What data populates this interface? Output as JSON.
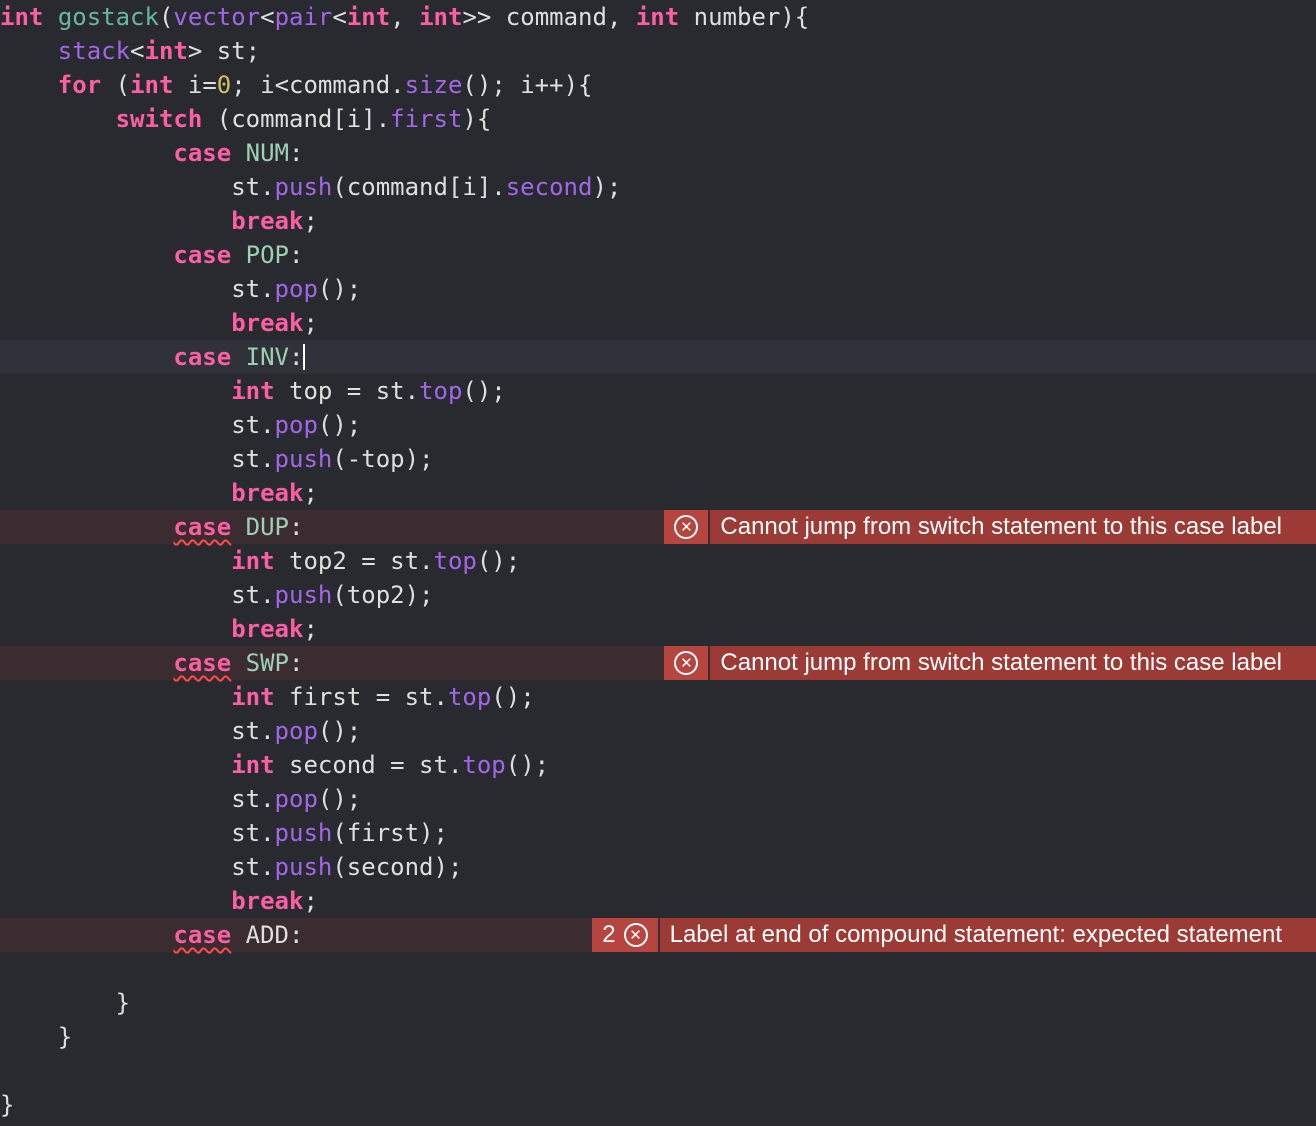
{
  "editor": {
    "lines": [
      {
        "tokens": [
          {
            "t": "int",
            "c": "kw"
          },
          {
            "t": " ",
            "c": "pl"
          },
          {
            "t": "gostack",
            "c": "fn"
          },
          {
            "t": "(",
            "c": "pl"
          },
          {
            "t": "vector",
            "c": "mem"
          },
          {
            "t": "<",
            "c": "pl"
          },
          {
            "t": "pair",
            "c": "mem"
          },
          {
            "t": "<",
            "c": "pl"
          },
          {
            "t": "int",
            "c": "kw"
          },
          {
            "t": ", ",
            "c": "pl"
          },
          {
            "t": "int",
            "c": "kw"
          },
          {
            "t": ">> command, ",
            "c": "pl"
          },
          {
            "t": "int",
            "c": "kw"
          },
          {
            "t": " number){",
            "c": "pl"
          }
        ]
      },
      {
        "tokens": [
          {
            "t": "    ",
            "c": "pl"
          },
          {
            "t": "stack",
            "c": "mem"
          },
          {
            "t": "<",
            "c": "pl"
          },
          {
            "t": "int",
            "c": "kw"
          },
          {
            "t": "> st;",
            "c": "pl"
          }
        ]
      },
      {
        "tokens": [
          {
            "t": "    ",
            "c": "pl"
          },
          {
            "t": "for",
            "c": "kw"
          },
          {
            "t": " (",
            "c": "pl"
          },
          {
            "t": "int",
            "c": "kw"
          },
          {
            "t": " i=",
            "c": "pl"
          },
          {
            "t": "0",
            "c": "num"
          },
          {
            "t": "; i<command.",
            "c": "pl"
          },
          {
            "t": "size",
            "c": "mem"
          },
          {
            "t": "(); i++){",
            "c": "pl"
          }
        ]
      },
      {
        "tokens": [
          {
            "t": "        ",
            "c": "pl"
          },
          {
            "t": "switch",
            "c": "kw"
          },
          {
            "t": " (command[i].",
            "c": "pl"
          },
          {
            "t": "first",
            "c": "mem"
          },
          {
            "t": "){",
            "c": "pl"
          }
        ]
      },
      {
        "tokens": [
          {
            "t": "            ",
            "c": "pl"
          },
          {
            "t": "case",
            "c": "kw"
          },
          {
            "t": " ",
            "c": "pl"
          },
          {
            "t": "NUM",
            "c": "enum"
          },
          {
            "t": ":",
            "c": "pl"
          }
        ]
      },
      {
        "tokens": [
          {
            "t": "                st.",
            "c": "pl"
          },
          {
            "t": "push",
            "c": "mem"
          },
          {
            "t": "(command[i].",
            "c": "pl"
          },
          {
            "t": "second",
            "c": "mem"
          },
          {
            "t": ");",
            "c": "pl"
          }
        ]
      },
      {
        "tokens": [
          {
            "t": "                ",
            "c": "pl"
          },
          {
            "t": "break",
            "c": "kw"
          },
          {
            "t": ";",
            "c": "pl"
          }
        ]
      },
      {
        "tokens": [
          {
            "t": "            ",
            "c": "pl"
          },
          {
            "t": "case",
            "c": "kw"
          },
          {
            "t": " ",
            "c": "pl"
          },
          {
            "t": "POP",
            "c": "enum"
          },
          {
            "t": ":",
            "c": "pl"
          }
        ]
      },
      {
        "tokens": [
          {
            "t": "                st.",
            "c": "pl"
          },
          {
            "t": "pop",
            "c": "mem"
          },
          {
            "t": "();",
            "c": "pl"
          }
        ]
      },
      {
        "tokens": [
          {
            "t": "                ",
            "c": "pl"
          },
          {
            "t": "break",
            "c": "kw"
          },
          {
            "t": ";",
            "c": "pl"
          }
        ]
      },
      {
        "current": true,
        "tokens": [
          {
            "t": "            ",
            "c": "pl"
          },
          {
            "t": "case",
            "c": "kw"
          },
          {
            "t": " ",
            "c": "pl"
          },
          {
            "t": "INV",
            "c": "enum"
          },
          {
            "t": ":",
            "c": "pl"
          }
        ]
      },
      {
        "tokens": [
          {
            "t": "                ",
            "c": "pl"
          },
          {
            "t": "int",
            "c": "kw"
          },
          {
            "t": " top = st.",
            "c": "pl"
          },
          {
            "t": "top",
            "c": "mem"
          },
          {
            "t": "();",
            "c": "pl"
          }
        ]
      },
      {
        "tokens": [
          {
            "t": "                st.",
            "c": "pl"
          },
          {
            "t": "pop",
            "c": "mem"
          },
          {
            "t": "();",
            "c": "pl"
          }
        ]
      },
      {
        "tokens": [
          {
            "t": "                st.",
            "c": "pl"
          },
          {
            "t": "push",
            "c": "mem"
          },
          {
            "t": "(-top);",
            "c": "pl"
          }
        ]
      },
      {
        "tokens": [
          {
            "t": "                ",
            "c": "pl"
          },
          {
            "t": "break",
            "c": "kw"
          },
          {
            "t": ";",
            "c": "pl"
          }
        ]
      },
      {
        "error": {
          "message": "Cannot jump from switch statement to this case label",
          "count": ""
        },
        "tokens": [
          {
            "t": "            ",
            "c": "pl"
          },
          {
            "t": "case",
            "c": "kw",
            "err": true
          },
          {
            "t": " ",
            "c": "pl"
          },
          {
            "t": "DUP",
            "c": "enum"
          },
          {
            "t": ":",
            "c": "pl"
          }
        ]
      },
      {
        "tokens": [
          {
            "t": "                ",
            "c": "pl"
          },
          {
            "t": "int",
            "c": "kw"
          },
          {
            "t": " top2 = st.",
            "c": "pl"
          },
          {
            "t": "top",
            "c": "mem"
          },
          {
            "t": "();",
            "c": "pl"
          }
        ]
      },
      {
        "tokens": [
          {
            "t": "                st.",
            "c": "pl"
          },
          {
            "t": "push",
            "c": "mem"
          },
          {
            "t": "(top2);",
            "c": "pl"
          }
        ]
      },
      {
        "tokens": [
          {
            "t": "                ",
            "c": "pl"
          },
          {
            "t": "break",
            "c": "kw"
          },
          {
            "t": ";",
            "c": "pl"
          }
        ]
      },
      {
        "error": {
          "message": "Cannot jump from switch statement to this case label",
          "count": ""
        },
        "tokens": [
          {
            "t": "            ",
            "c": "pl"
          },
          {
            "t": "case",
            "c": "kw",
            "err": true
          },
          {
            "t": " ",
            "c": "pl"
          },
          {
            "t": "SWP",
            "c": "enum"
          },
          {
            "t": ":",
            "c": "pl"
          }
        ]
      },
      {
        "tokens": [
          {
            "t": "                ",
            "c": "pl"
          },
          {
            "t": "int",
            "c": "kw"
          },
          {
            "t": " first = st.",
            "c": "pl"
          },
          {
            "t": "top",
            "c": "mem"
          },
          {
            "t": "();",
            "c": "pl"
          }
        ]
      },
      {
        "tokens": [
          {
            "t": "                st.",
            "c": "pl"
          },
          {
            "t": "pop",
            "c": "mem"
          },
          {
            "t": "();",
            "c": "pl"
          }
        ]
      },
      {
        "tokens": [
          {
            "t": "                ",
            "c": "pl"
          },
          {
            "t": "int",
            "c": "kw"
          },
          {
            "t": " second = st.",
            "c": "pl"
          },
          {
            "t": "top",
            "c": "mem"
          },
          {
            "t": "();",
            "c": "pl"
          }
        ]
      },
      {
        "tokens": [
          {
            "t": "                st.",
            "c": "pl"
          },
          {
            "t": "pop",
            "c": "mem"
          },
          {
            "t": "();",
            "c": "pl"
          }
        ]
      },
      {
        "tokens": [
          {
            "t": "                st.",
            "c": "pl"
          },
          {
            "t": "push",
            "c": "mem"
          },
          {
            "t": "(first);",
            "c": "pl"
          }
        ]
      },
      {
        "tokens": [
          {
            "t": "                st.",
            "c": "pl"
          },
          {
            "t": "push",
            "c": "mem"
          },
          {
            "t": "(second);",
            "c": "pl"
          }
        ]
      },
      {
        "tokens": [
          {
            "t": "                ",
            "c": "pl"
          },
          {
            "t": "break",
            "c": "kw"
          },
          {
            "t": ";",
            "c": "pl"
          }
        ]
      },
      {
        "error": {
          "message": "Label at end of compound statement: expected statement",
          "count": "2"
        },
        "tokens": [
          {
            "t": "            ",
            "c": "pl"
          },
          {
            "t": "case",
            "c": "kw",
            "err": true
          },
          {
            "t": " ADD:",
            "c": "pl"
          }
        ]
      },
      {
        "tokens": []
      },
      {
        "tokens": [
          {
            "t": "        }",
            "c": "pl"
          }
        ]
      },
      {
        "tokens": [
          {
            "t": "    }",
            "c": "pl"
          }
        ]
      },
      {
        "tokens": []
      },
      {
        "tokens": [
          {
            "t": "}",
            "c": "pl"
          }
        ]
      }
    ]
  },
  "icons": {
    "error_icon": "circle-x"
  },
  "colors": {
    "background": "#292a30",
    "keyword": "#fc5fa3",
    "function": "#67b7a4",
    "member": "#a167e6",
    "enum_case": "#9ed0b6",
    "number": "#d0bf69",
    "plain": "#dfdfe0",
    "error_banner": "#9c3b36",
    "error_line": "#3a2c30"
  }
}
